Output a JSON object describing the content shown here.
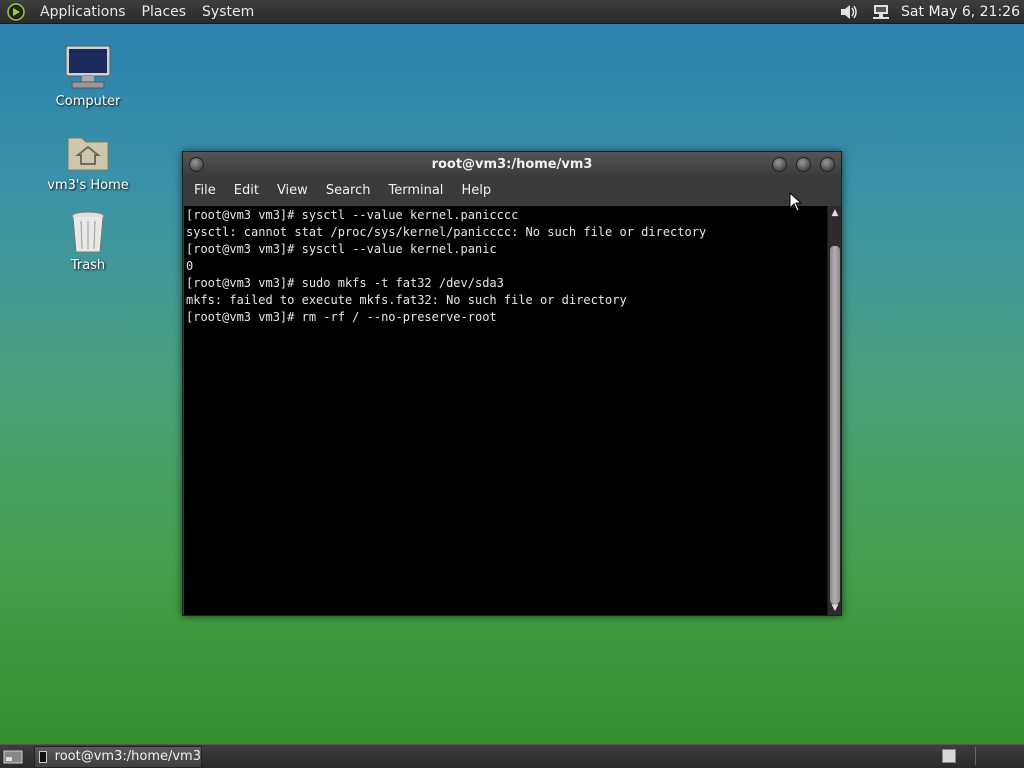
{
  "top_panel": {
    "menus": [
      "Applications",
      "Places",
      "System"
    ],
    "clock": "Sat May  6, 21:26",
    "icons": [
      "distro-logo-icon",
      "volume-icon",
      "network-icon"
    ]
  },
  "desktop": {
    "icons": [
      {
        "label": "Computer",
        "icon": "computer-icon"
      },
      {
        "label": "vm3's Home",
        "icon": "home-folder-icon"
      },
      {
        "label": "Trash",
        "icon": "trash-icon"
      }
    ]
  },
  "terminal": {
    "title": "root@vm3:/home/vm3",
    "menu": [
      "File",
      "Edit",
      "View",
      "Search",
      "Terminal",
      "Help"
    ],
    "lines": [
      "[root@vm3 vm3]# sysctl --value kernel.panicccc",
      "sysctl: cannot stat /proc/sys/kernel/panicccc: No such file or directory",
      "[root@vm3 vm3]# sysctl --value kernel.panic",
      "0",
      "[root@vm3 vm3]# sudo mkfs -t fat32 /dev/sda3",
      "mkfs: failed to execute mkfs.fat32: No such file or directory",
      "[root@vm3 vm3]# rm -rf / --no-preserve-root"
    ]
  },
  "taskbar": {
    "task_label": "root@vm3:/home/vm3"
  },
  "colors": {
    "terminal_bg": "#000000",
    "terminal_fg": "#e6e6e6",
    "panel_bg": "#333333"
  }
}
